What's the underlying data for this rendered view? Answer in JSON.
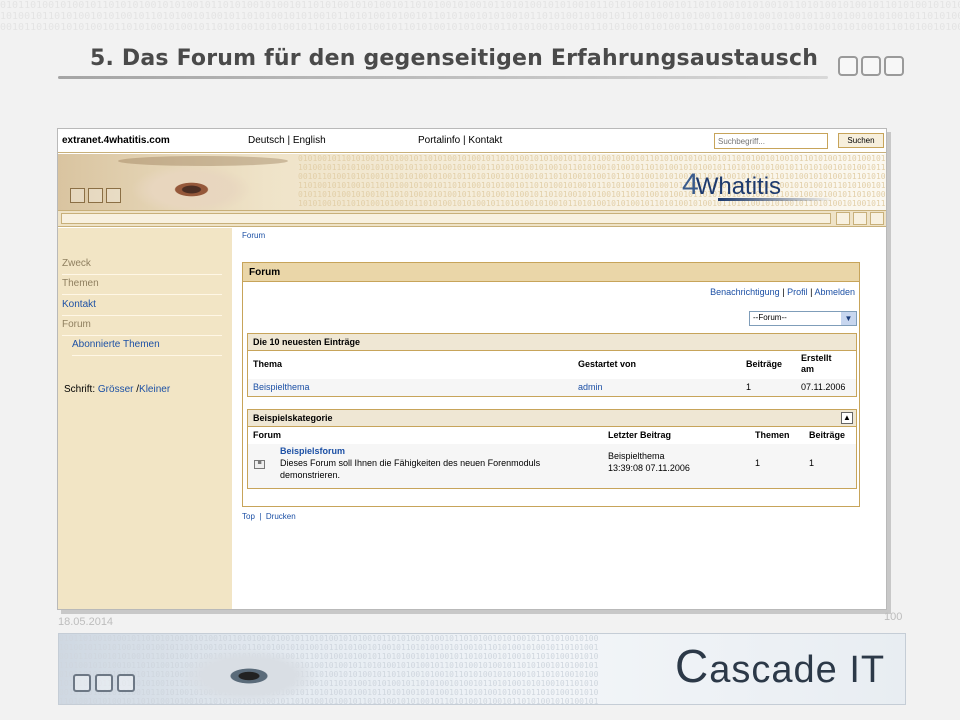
{
  "slide": {
    "title": "5. Das Forum für den gegenseitigen Erfahrungsaustausch",
    "date": "18.05.2014",
    "page_number": "100",
    "footer_logo": "ascade IT",
    "footer_logo_initial": "C"
  },
  "portal": {
    "site_name": "extranet.4whatitis.com",
    "language_links": "Deutsch | English",
    "portal_links": "Portalinfo | Kontakt",
    "search_placeholder": "Suchbegriff...",
    "search_button": "Suchen",
    "logo_prefix": "4",
    "logo_text": "Whatitis"
  },
  "sidebar": {
    "items": [
      {
        "label": "Zweck"
      },
      {
        "label": "Themen"
      },
      {
        "label": "Kontakt"
      },
      {
        "label": "Forum"
      },
      {
        "label": "Abonnierte Themen"
      }
    ],
    "font_label": "Schrift:",
    "font_bigger": "Grösser",
    "font_separator": "/",
    "font_smaller": "Kleiner"
  },
  "main": {
    "breadcrumb": "Forum",
    "forum_title": "Forum",
    "links": {
      "notify": "Benachrichtigung",
      "profile": "Profil",
      "logout": "Abmelden",
      "sep": "|"
    },
    "forum_select": "--Forum--",
    "latest": {
      "title": "Die 10 neuesten Einträge",
      "columns": [
        "Thema",
        "Gestartet von",
        "Beiträge",
        "Erstellt",
        "am"
      ],
      "rows": [
        {
          "topic": "Beispielthema",
          "started_by": "admin",
          "posts": "1",
          "created": "07.11.2006"
        }
      ]
    },
    "category": {
      "title": "Beispielskategorie",
      "columns": [
        "Forum",
        "Letzter Beitrag",
        "Themen",
        "Beiträge"
      ],
      "forum_name": "Beispielsforum",
      "forum_desc_1": "Dieses Forum soll Ihnen die Fähigkeiten des neuen Forenmoduls",
      "forum_desc_2": "demonstrieren.",
      "last_post_topic": "Beispielthema",
      "last_post_time": "13:39:08 07.11.2006",
      "topics": "1",
      "posts": "1"
    },
    "bottom_top": "Top",
    "bottom_sep": "|",
    "bottom_print": "Drucken"
  }
}
